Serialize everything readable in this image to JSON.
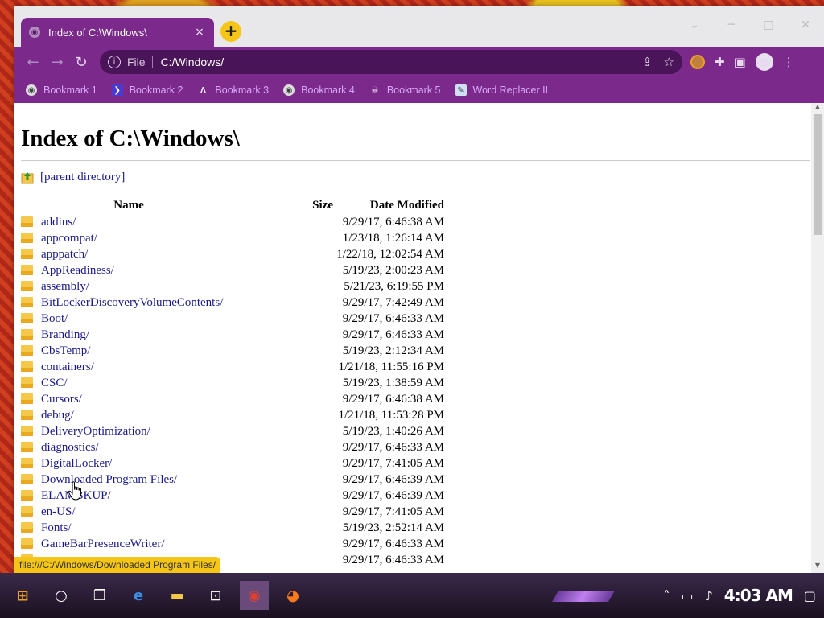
{
  "browser": {
    "tab_title": "Index of C:\\Windows\\",
    "tab_close": "×",
    "new_tab": "+",
    "window_controls": {
      "minimize": "─",
      "maximize": "□",
      "close": "✕",
      "chevron": "⌄"
    },
    "omnibox": {
      "scheme": "File",
      "url": "C:/Windows/"
    },
    "bookmarks": [
      {
        "label": "Bookmark 1",
        "icon": "globe-icon"
      },
      {
        "label": "Bookmark 2",
        "icon": "bookmark-icon"
      },
      {
        "label": "Bookmark 3",
        "icon": "lambda-icon"
      },
      {
        "label": "Bookmark 4",
        "icon": "globe-icon"
      },
      {
        "label": "Bookmark 5",
        "icon": "skull-icon"
      },
      {
        "label": "Word Replacer II",
        "icon": "extension-icon"
      }
    ]
  },
  "page": {
    "heading": "Index of C:\\Windows\\",
    "parent_link": "[parent directory]",
    "columns": {
      "name": "Name",
      "size": "Size",
      "date": "Date Modified"
    },
    "entries": [
      {
        "name": "addins/",
        "size": "",
        "date": "9/29/17, 6:46:38 AM"
      },
      {
        "name": "appcompat/",
        "size": "",
        "date": "1/23/18, 1:26:14 AM"
      },
      {
        "name": "apppatch/",
        "size": "",
        "date": "1/22/18, 12:02:54 AM"
      },
      {
        "name": "AppReadiness/",
        "size": "",
        "date": "5/19/23, 2:00:23 AM"
      },
      {
        "name": "assembly/",
        "size": "",
        "date": "5/21/23, 6:19:55 PM"
      },
      {
        "name": "BitLockerDiscoveryVolumeContents/",
        "size": "",
        "date": "9/29/17, 7:42:49 AM"
      },
      {
        "name": "Boot/",
        "size": "",
        "date": "9/29/17, 6:46:33 AM"
      },
      {
        "name": "Branding/",
        "size": "",
        "date": "9/29/17, 6:46:33 AM"
      },
      {
        "name": "CbsTemp/",
        "size": "",
        "date": "5/19/23, 2:12:34 AM"
      },
      {
        "name": "containers/",
        "size": "",
        "date": "1/21/18, 11:55:16 PM"
      },
      {
        "name": "CSC/",
        "size": "",
        "date": "5/19/23, 1:38:59 AM"
      },
      {
        "name": "Cursors/",
        "size": "",
        "date": "9/29/17, 6:46:38 AM"
      },
      {
        "name": "debug/",
        "size": "",
        "date": "1/21/18, 11:53:28 PM"
      },
      {
        "name": "DeliveryOptimization/",
        "size": "",
        "date": "5/19/23, 1:40:26 AM"
      },
      {
        "name": "diagnostics/",
        "size": "",
        "date": "9/29/17, 6:46:33 AM"
      },
      {
        "name": "DigitalLocker/",
        "size": "",
        "date": "9/29/17, 7:41:05 AM"
      },
      {
        "name": "Downloaded Program Files/",
        "size": "",
        "date": "9/29/17, 6:46:39 AM"
      },
      {
        "name": "ELAMBKUP/",
        "size": "",
        "date": "9/29/17, 6:46:39 AM"
      },
      {
        "name": "en-US/",
        "size": "",
        "date": "9/29/17, 7:41:05 AM"
      },
      {
        "name": "Fonts/",
        "size": "",
        "date": "5/19/23, 2:52:14 AM"
      },
      {
        "name": "GameBarPresenceWriter/",
        "size": "",
        "date": "9/29/17, 6:46:33 AM"
      },
      {
        "name": "",
        "size": "",
        "date": "9/29/17, 6:46:33 AM"
      }
    ],
    "hovered_entry": "Downloaded Program Files/"
  },
  "status_bar": "file:///C:/Windows/Downloaded Program Files/",
  "taskbar": {
    "clock": "4:03 AM",
    "apps": [
      "start-icon",
      "cortana-icon",
      "task-view-icon",
      "edge-icon",
      "file-explorer-icon",
      "store-icon",
      "chrome-icon",
      "firefox-icon"
    ]
  },
  "colors": {
    "browser_theme": "#7b2a8c",
    "status_bar": "#f5c518",
    "link": "#1a1a8c"
  }
}
